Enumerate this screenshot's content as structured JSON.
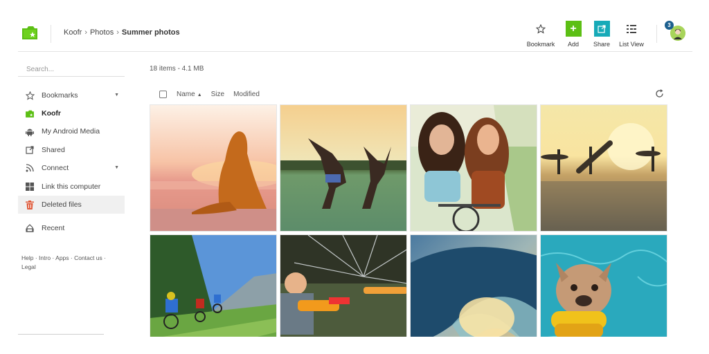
{
  "header": {
    "breadcrumb": [
      "Koofr",
      "Photos",
      "Summer photos"
    ],
    "tools": {
      "bookmark": "Bookmark",
      "add": "Add",
      "share": "Share",
      "list_view": "List View"
    },
    "notification_count": "3",
    "icons": {
      "logo": "koofr-logo",
      "bookmark": "star-icon",
      "add": "plus-icon",
      "share": "share-icon",
      "list_view": "list-view-icon",
      "avatar": "user-avatar"
    }
  },
  "sidebar": {
    "search_placeholder": "Search...",
    "items": [
      {
        "label": "Bookmarks",
        "icon": "star-icon",
        "has_caret": true
      },
      {
        "label": "Koofr",
        "icon": "koofr-folder-icon",
        "bold": true
      },
      {
        "label": "My Android Media",
        "icon": "android-icon"
      },
      {
        "label": "Shared",
        "icon": "share-icon"
      },
      {
        "label": "Connect",
        "icon": "rss-icon",
        "has_caret": true
      },
      {
        "label": "Link this computer",
        "icon": "windows-icon"
      },
      {
        "label": "Deleted files",
        "icon": "trash-icon",
        "selected": true
      },
      {
        "label": "Recent",
        "icon": "recent-icon"
      }
    ],
    "footer_links": [
      "Help",
      "Intro",
      "Apps",
      "Contact us",
      "Legal"
    ]
  },
  "main": {
    "summary": "18 items - 4.1 MB",
    "columns": {
      "name": "Name",
      "size": "Size",
      "modified": "Modified"
    },
    "sort": {
      "column": "Name",
      "direction": "ascending"
    },
    "photos": [
      {
        "subject": "woman sitting on beach at sunset"
      },
      {
        "subject": "two people jumping by the lake"
      },
      {
        "subject": "two girls with bicycle"
      },
      {
        "subject": "surfers on beach at sunset"
      },
      {
        "subject": "mountain bikers on hillside"
      },
      {
        "subject": "kid with water sprinkler"
      },
      {
        "subject": "ocean wave"
      },
      {
        "subject": "dog swimming in pool"
      }
    ]
  },
  "colors": {
    "accent_green": "#5cbf14",
    "share_teal": "#17aab8",
    "trash_red": "#e05a3a",
    "badge_blue": "#1b5f8e"
  }
}
